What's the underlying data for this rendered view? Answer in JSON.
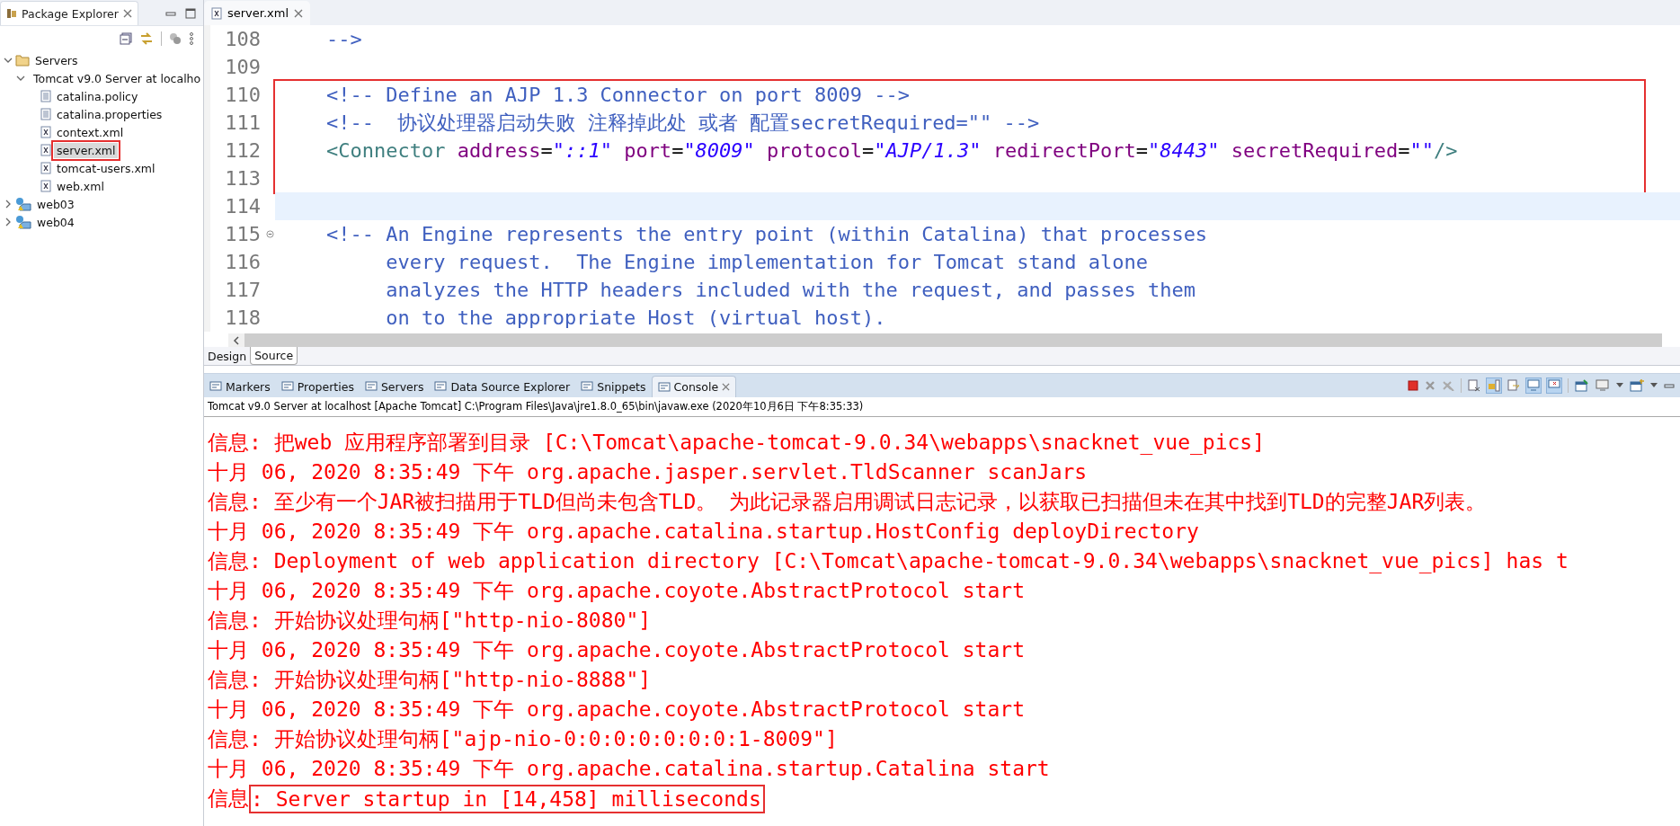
{
  "package_explorer": {
    "title": "Package Explorer",
    "tree": [
      {
        "label": "Servers",
        "kind": "folder",
        "expanded": true,
        "selected": false,
        "boxed": false,
        "children": [
          {
            "label": "Tomcat v9.0 Server at localho",
            "kind": "folder",
            "expanded": true,
            "selected": false,
            "boxed": false,
            "children": [
              {
                "label": "catalina.policy",
                "kind": "file",
                "selected": false,
                "boxed": false
              },
              {
                "label": "catalina.properties",
                "kind": "file",
                "selected": false,
                "boxed": false
              },
              {
                "label": "context.xml",
                "kind": "xml",
                "selected": false,
                "boxed": false
              },
              {
                "label": "server.xml",
                "kind": "xml",
                "selected": true,
                "boxed": true
              },
              {
                "label": "tomcat-users.xml",
                "kind": "xml",
                "selected": false,
                "boxed": false
              },
              {
                "label": "web.xml",
                "kind": "xml",
                "selected": false,
                "boxed": false
              }
            ]
          }
        ]
      },
      {
        "label": "web03",
        "kind": "project",
        "expanded": false,
        "selected": false,
        "boxed": false
      },
      {
        "label": "web04",
        "kind": "project",
        "expanded": false,
        "selected": false,
        "boxed": false
      }
    ]
  },
  "editor": {
    "tab": "server.xml",
    "lines": [
      {
        "number": "108",
        "current": false,
        "boxed": false,
        "tokens": [
          {
            "kind": "comment",
            "text": "    -->"
          }
        ]
      },
      {
        "number": "109",
        "current": false,
        "boxed": false
      },
      {
        "number": "110",
        "current": false,
        "boxed": true,
        "tokens": [
          {
            "kind": "comment",
            "text": "    <!-- Define an AJP 1.3 Connector on port 8009 -->"
          }
        ]
      },
      {
        "number": "111",
        "current": false,
        "boxed": true,
        "tokens": [
          {
            "kind": "comment",
            "text": "    <!--  协议处理器启动失败 注释掉此处 或者 配置secretRequired=\"\" -->"
          }
        ]
      },
      {
        "number": "112",
        "current": false,
        "boxed": true,
        "tokens": [
          {
            "kind": "tag",
            "text": "    <Connector"
          },
          {
            "kind": "attr",
            "text": " address"
          },
          {
            "kind": "text",
            "text": "="
          },
          {
            "kind": "value",
            "text": "\"::1\""
          },
          {
            "kind": "attr",
            "text": " port"
          },
          {
            "kind": "text",
            "text": "="
          },
          {
            "kind": "value",
            "text": "\"8009\""
          },
          {
            "kind": "attr",
            "text": " protocol"
          },
          {
            "kind": "text",
            "text": "="
          },
          {
            "kind": "value",
            "text": "\"AJP/1.3\""
          },
          {
            "kind": "attr",
            "text": " redirectPort"
          },
          {
            "kind": "text",
            "text": "="
          },
          {
            "kind": "value",
            "text": "\"8443\""
          },
          {
            "kind": "attr",
            "text": " secretRequired"
          },
          {
            "kind": "text",
            "text": "="
          },
          {
            "kind": "value",
            "text": "\"\""
          },
          {
            "kind": "tag",
            "text": "/>"
          }
        ]
      },
      {
        "number": "113",
        "current": false,
        "boxed": true
      },
      {
        "number": "114",
        "current": true,
        "boxed": false
      },
      {
        "number": "115",
        "current": false,
        "boxed": false,
        "expanded": true,
        "tokens": [
          {
            "kind": "comment",
            "text": "    <!-- An Engine represents the entry point (within Catalina) that processes"
          }
        ]
      },
      {
        "number": "116",
        "current": false,
        "boxed": false,
        "tokens": [
          {
            "kind": "comment",
            "text": "         every request.  The Engine implementation for Tomcat stand alone"
          }
        ]
      },
      {
        "number": "117",
        "current": false,
        "boxed": false,
        "tokens": [
          {
            "kind": "comment",
            "text": "         analyzes the HTTP headers included with the request, and passes them"
          }
        ]
      },
      {
        "number": "118",
        "current": false,
        "boxed": false,
        "tokens": [
          {
            "kind": "comment",
            "text": "         on to the appropriate Host (virtual host)."
          }
        ]
      }
    ],
    "bottom_tabs": [
      {
        "label": "Design",
        "selected": false
      },
      {
        "label": "Source",
        "selected": true
      }
    ]
  },
  "console": {
    "tabs": [
      {
        "label": "Markers",
        "selected": false
      },
      {
        "label": "Properties",
        "selected": false
      },
      {
        "label": "Servers",
        "selected": false
      },
      {
        "label": "Data Source Explorer",
        "selected": false
      },
      {
        "label": "Snippets",
        "selected": false
      },
      {
        "label": "Console",
        "selected": true
      }
    ],
    "process": "Tomcat v9.0 Server at localhost [Apache Tomcat] C:\\Program Files\\Java\\jre1.8.0_65\\bin\\javaw.exe (2020年10月6日 下午8:35:33)",
    "lines": [
      {
        "parts": [
          {
            "text": "信息: 把web 应用程序部署到目录 [C:\\Tomcat\\apache-tomcat-9.0.34\\webapps\\snacknet_vue_pics]",
            "boxed": false
          }
        ]
      },
      {
        "parts": [
          {
            "text": "十月 06, 2020 8:35:49 下午 org.apache.jasper.servlet.TldScanner scanJars",
            "boxed": false
          }
        ]
      },
      {
        "parts": [
          {
            "text": "信息: 至少有一个JAR被扫描用于TLD但尚未包含TLD。 为此记录器启用调试日志记录，以获取已扫描但未在其中找到TLD的完整JAR列表。",
            "boxed": false
          }
        ]
      },
      {
        "parts": [
          {
            "text": "十月 06, 2020 8:35:49 下午 org.apache.catalina.startup.HostConfig deployDirectory",
            "boxed": false
          }
        ]
      },
      {
        "parts": [
          {
            "text": "信息: Deployment of web application directory [C:\\Tomcat\\apache-tomcat-9.0.34\\webapps\\snacknet_vue_pics] has t",
            "boxed": false
          }
        ]
      },
      {
        "parts": [
          {
            "text": "十月 06, 2020 8:35:49 下午 org.apache.coyote.AbstractProtocol start",
            "boxed": false
          }
        ]
      },
      {
        "parts": [
          {
            "text": "信息: 开始协议处理句柄[\"http-nio-8080\"]",
            "boxed": false
          }
        ]
      },
      {
        "parts": [
          {
            "text": "十月 06, 2020 8:35:49 下午 org.apache.coyote.AbstractProtocol start",
            "boxed": false
          }
        ]
      },
      {
        "parts": [
          {
            "text": "信息: 开始协议处理句柄[\"http-nio-8888\"]",
            "boxed": false
          }
        ]
      },
      {
        "parts": [
          {
            "text": "十月 06, 2020 8:35:49 下午 org.apache.coyote.AbstractProtocol start",
            "boxed": false
          }
        ]
      },
      {
        "parts": [
          {
            "text": "信息: 开始协议处理句柄[\"ajp-nio-0:0:0:0:0:0:0:1-8009\"]",
            "boxed": false
          }
        ]
      },
      {
        "parts": [
          {
            "text": "十月 06, 2020 8:35:49 下午 org.apache.catalina.startup.Catalina start",
            "boxed": false
          }
        ]
      },
      {
        "parts": [
          {
            "text": "信息",
            "boxed": false
          },
          {
            "text": ": Server startup in [14,458] milliseconds",
            "boxed": true
          }
        ]
      }
    ]
  }
}
